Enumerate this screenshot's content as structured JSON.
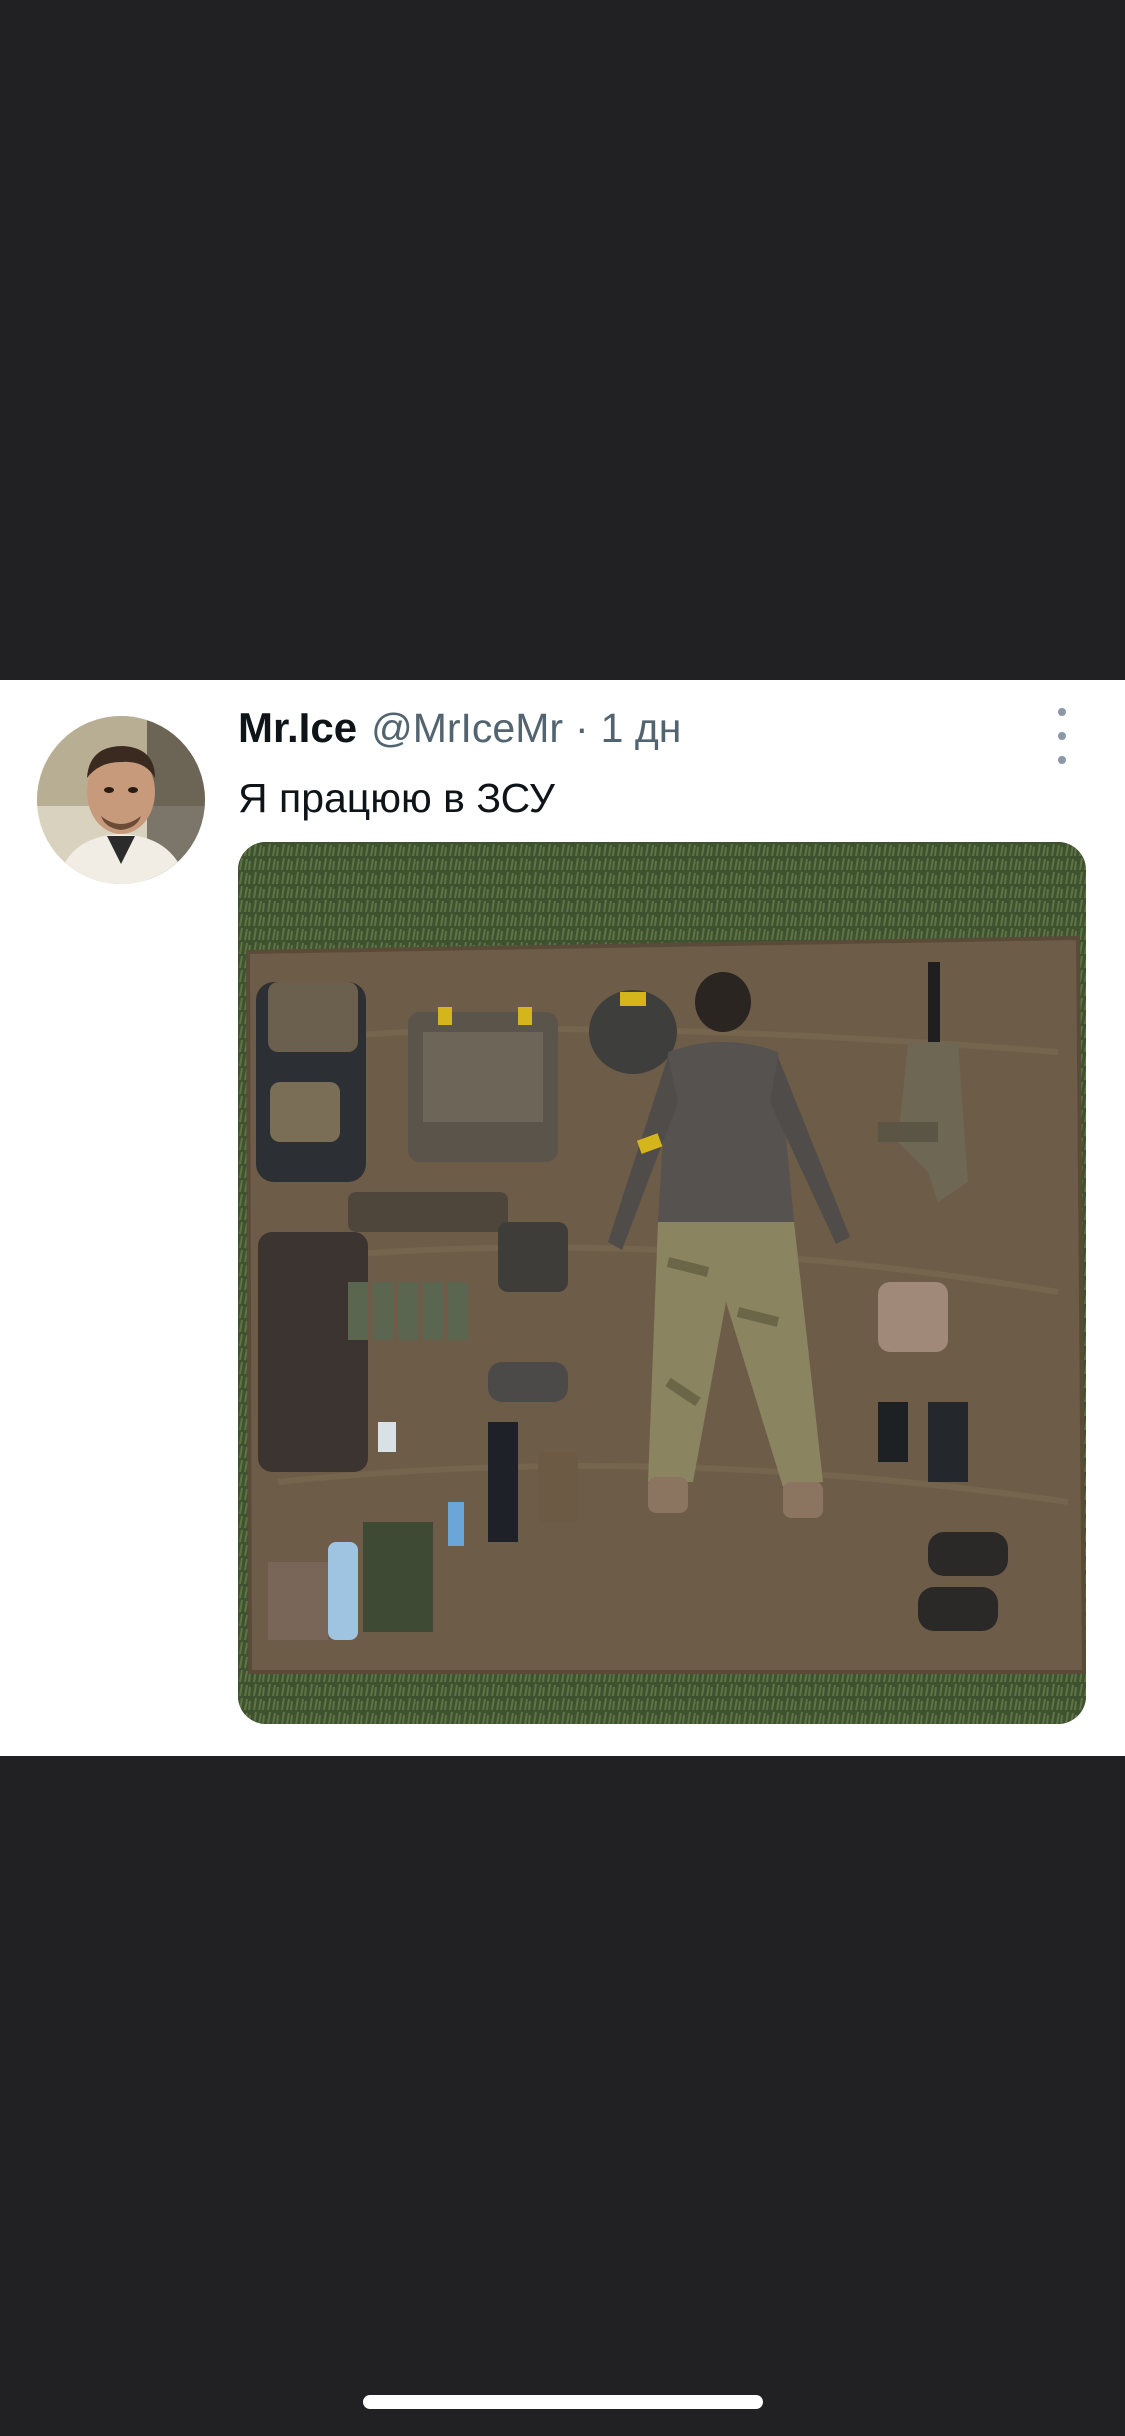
{
  "tweet": {
    "display_name": "Mr.Ice",
    "handle": "@MrIceMr",
    "separator": "·",
    "time": "1 дн",
    "text": "Я працюю в ЗСУ",
    "avatar_icon": "user-avatar-photo",
    "more_icon": "more-options-icon",
    "media_description_icon": "tweet-photo"
  },
  "colors": {
    "background": "#212124",
    "card": "#ffffff",
    "name": "#0f1419",
    "secondary": "#536471"
  }
}
